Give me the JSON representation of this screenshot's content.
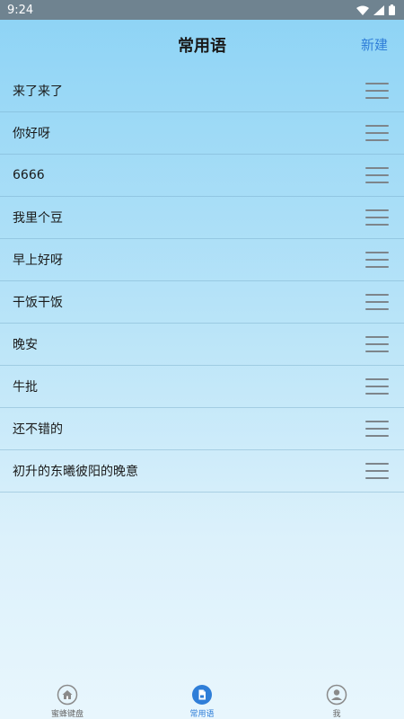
{
  "status_bar": {
    "time": "9:24"
  },
  "header": {
    "title": "常用语",
    "new_label": "新建"
  },
  "phrases": [
    "来了来了",
    "你好呀",
    "6666",
    "我里个豆",
    "早上好呀",
    "干饭干饭",
    "晚安",
    "牛批",
    "还不错的",
    "初升的东曦彼阳的晚意"
  ],
  "bottom_nav": {
    "items": [
      {
        "label": "蜜蜂键盘",
        "icon": "home-icon"
      },
      {
        "label": "常用语",
        "icon": "document-icon",
        "active": true
      },
      {
        "label": "我",
        "icon": "person-icon"
      }
    ]
  },
  "colors": {
    "accent": "#2f7ed8",
    "status_bar": "#6f8390"
  }
}
